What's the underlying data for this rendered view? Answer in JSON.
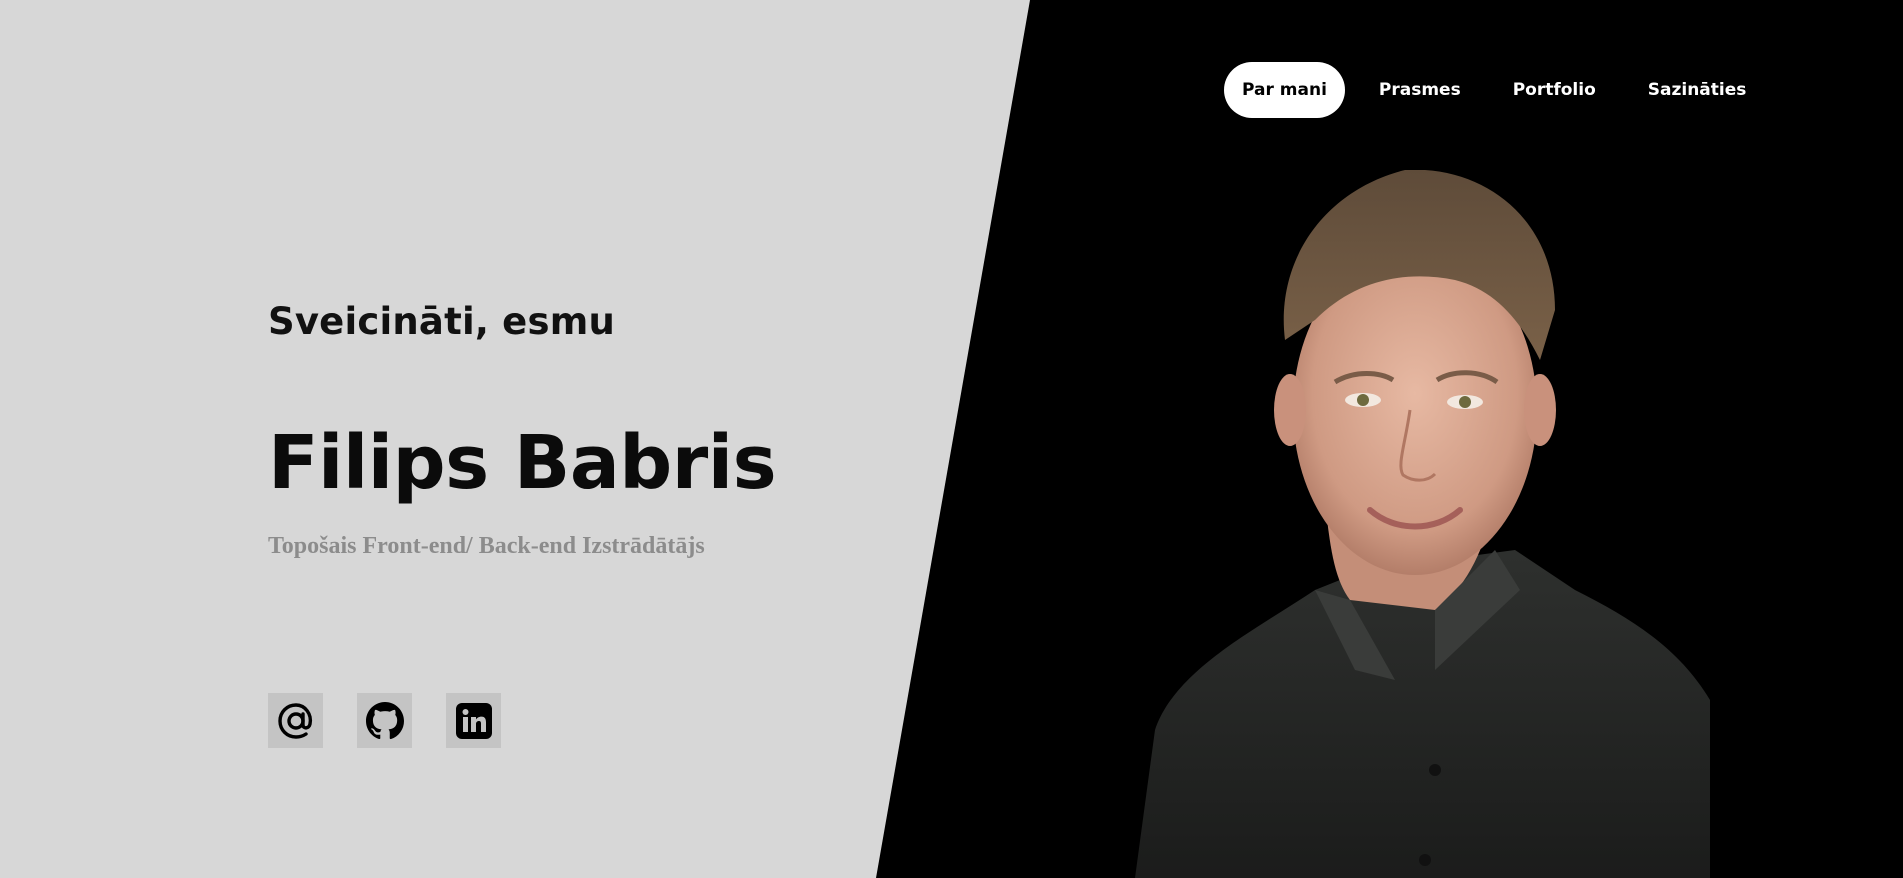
{
  "nav": {
    "items": [
      {
        "label": "Par mani",
        "active": true
      },
      {
        "label": "Prasmes",
        "active": false
      },
      {
        "label": "Portfolio",
        "active": false
      },
      {
        "label": "Sazināties",
        "active": false
      }
    ]
  },
  "hero": {
    "greeting": "Sveicināti, esmu",
    "name": "Filips Babris",
    "role": "Topošais Front-end/ Back-end Izstrādātājs"
  },
  "socials": [
    {
      "icon": "at-sign-icon"
    },
    {
      "icon": "github-icon"
    },
    {
      "icon": "linkedin-icon"
    }
  ],
  "colors": {
    "left_panel_bg": "#d7d7d7",
    "right_panel_bg": "#000000",
    "active_nav_bg": "#ffffff",
    "role_text": "#8c8c8c"
  }
}
